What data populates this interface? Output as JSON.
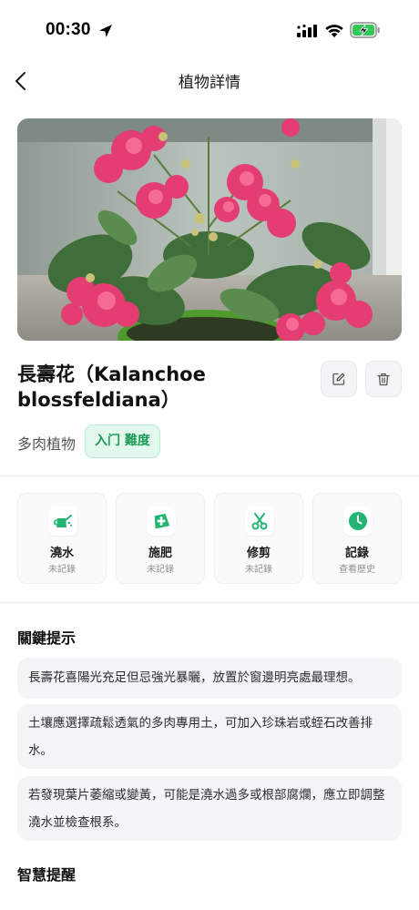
{
  "status_bar": {
    "time": "00:30",
    "location_icon": "location-arrow-icon",
    "signal_icon": "cellular-signal-icon",
    "wifi_icon": "wifi-icon",
    "battery_icon": "battery-charging-icon",
    "battery_color": "#34c759"
  },
  "nav": {
    "title": "植物詳情",
    "back_icon": "chevron-left-icon"
  },
  "plant": {
    "name": "長壽花（Kalanchoe blossfeldiana）",
    "category": "多肉植物",
    "difficulty": "入门 難度",
    "photo_description_icon": "plant-photo"
  },
  "header_actions": {
    "edit_icon": "edit-icon",
    "delete_icon": "trash-icon"
  },
  "care_actions": [
    {
      "label": "澆水",
      "status": "未記錄",
      "icon": "watering-can-icon"
    },
    {
      "label": "施肥",
      "status": "未記錄",
      "icon": "fertilizer-bag-icon"
    },
    {
      "label": "修剪",
      "status": "未記錄",
      "icon": "scissors-icon"
    },
    {
      "label": "記錄",
      "status": "查看歷史",
      "icon": "clock-icon"
    }
  ],
  "accent_color": "#22b573",
  "key_tips": {
    "title": "關鍵提示",
    "items": [
      "長壽花喜陽光充足但忌強光暴曬，放置於窗邊明亮處最理想。",
      "土壤應選擇疏鬆透氣的多肉專用土，可加入珍珠岩或蛭石改善排水。",
      "若發現葉片萎縮或變黃，可能是澆水過多或根部腐爛，應立即調整澆水並檢查根系。"
    ]
  },
  "smart_reminder": {
    "title": "智慧提醒"
  }
}
